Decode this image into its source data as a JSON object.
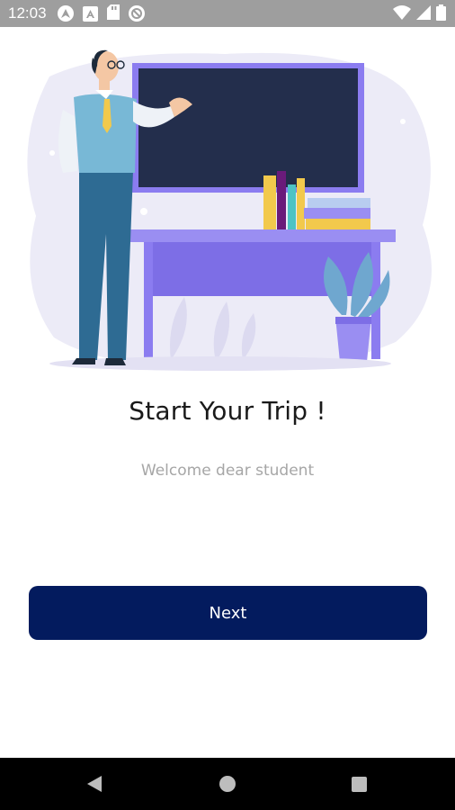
{
  "status_bar": {
    "time": "12:03",
    "icons_left": [
      "android-auto-icon",
      "a-badge-icon",
      "sd-card-icon",
      "no-disturb-icon"
    ],
    "icons_right": [
      "wifi-icon",
      "signal-icon",
      "battery-icon"
    ]
  },
  "onboarding": {
    "title": "Start Your Trip !",
    "subtitle": "Welcome dear student",
    "next_label": "Next"
  },
  "colors": {
    "button": "#031b5e",
    "accent_purple": "#8b7cf0",
    "board": "#232e4c"
  },
  "nav_bar": {
    "buttons": [
      "back-icon",
      "home-icon",
      "recents-icon"
    ]
  }
}
